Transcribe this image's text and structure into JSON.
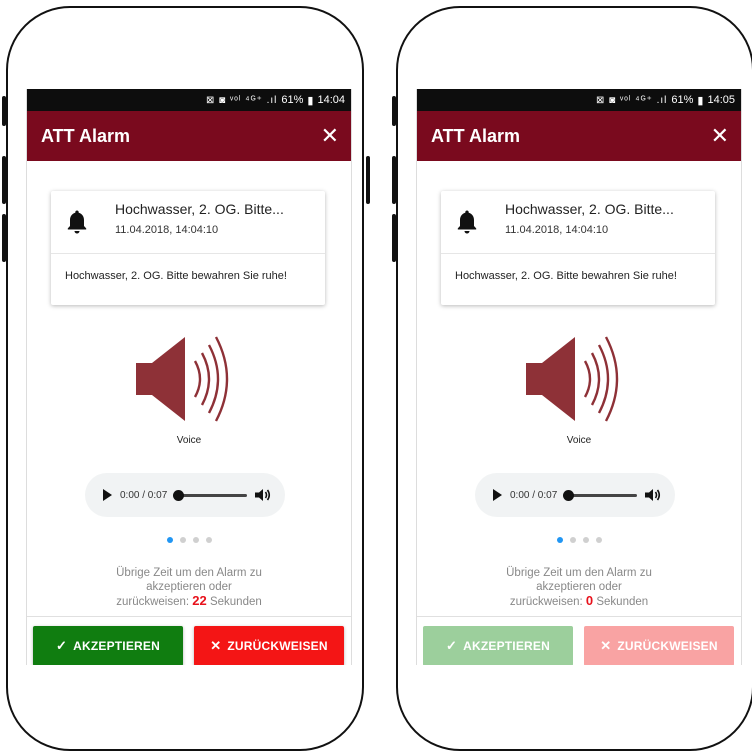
{
  "screens": [
    {
      "status": {
        "icons": "⊠ ◙ ᵛᵒˡ ⁴ᴳ⁺ .ıl",
        "battery": "61%",
        "time": "14:04"
      },
      "app_title": "ATT Alarm",
      "card": {
        "subject": "Hochwasser, 2. OG. Bitte...",
        "datetime": "11.04.2018, 14:04:10",
        "message": "Hochwasser, 2. OG. Bitte bewahren Sie ruhe!"
      },
      "media_label": "Voice",
      "audio": {
        "time": "0:00 / 0:07",
        "progress": 0
      },
      "pagination": {
        "count": 4,
        "active": 0
      },
      "remaining": {
        "line1": "Übrige Zeit um den Alarm zu",
        "line2": "akzeptieren oder",
        "prefix": "zurückweisen:",
        "count": "22",
        "suffix": "Sekunden"
      },
      "buttons": {
        "accept": "AKZEPTIEREN",
        "reject": "ZURÜCKWEISEN",
        "enabled": true
      }
    },
    {
      "status": {
        "icons": "⊠ ◙ ᵛᵒˡ ⁴ᴳ⁺ .ıl",
        "battery": "61%",
        "time": "14:05"
      },
      "app_title": "ATT Alarm",
      "card": {
        "subject": "Hochwasser, 2. OG. Bitte...",
        "datetime": "11.04.2018, 14:04:10",
        "message": "Hochwasser, 2. OG. Bitte bewahren Sie ruhe!"
      },
      "media_label": "Voice",
      "audio": {
        "time": "0:00 / 0:07",
        "progress": 0
      },
      "pagination": {
        "count": 4,
        "active": 0
      },
      "remaining": {
        "line1": "Übrige Zeit um den Alarm zu",
        "line2": "akzeptieren oder",
        "prefix": "zurückweisen:",
        "count": "0",
        "suffix": "Sekunden"
      },
      "buttons": {
        "accept": "AKZEPTIEREN",
        "reject": "ZURÜCKWEISEN",
        "enabled": false
      }
    }
  ],
  "colors": {
    "appbar": "#7a0a1e",
    "accept": "#107d10",
    "reject": "#f41515",
    "accept_disabled": "#9ccf9c",
    "reject_disabled": "#f9a3a3",
    "speaker": "#8e3137",
    "countdown": "#e8121c",
    "active_dot": "#2196f3"
  },
  "icons": [
    "bell-icon",
    "close-icon",
    "speaker-icon",
    "play-icon",
    "volume-icon",
    "check-icon",
    "x-icon"
  ]
}
